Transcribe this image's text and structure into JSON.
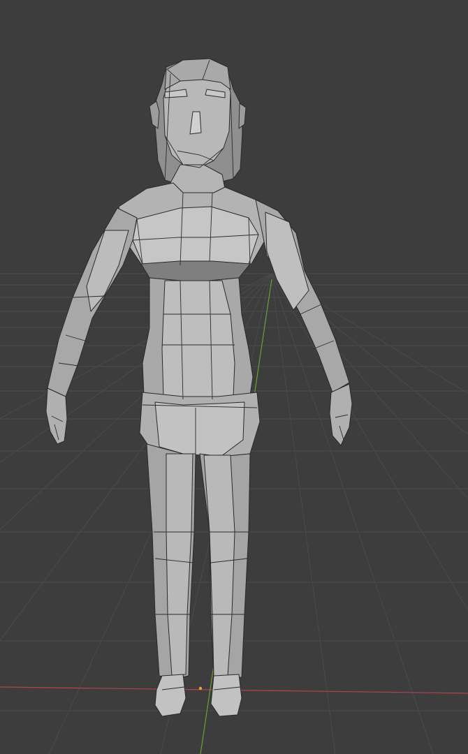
{
  "viewport": {
    "background": "#3d3d3d",
    "grid_color": "#4a4a4a",
    "x_axis_color": "#b3444f",
    "y_axis_color": "#6e9f2f",
    "origin_color": "#f0a030"
  },
  "model": {
    "shading": "solid",
    "base_color": "#a6a6a6",
    "highlight_color": "#c4c4c4",
    "shadow_color": "#848484",
    "edge_color": "#2a2a2a"
  }
}
